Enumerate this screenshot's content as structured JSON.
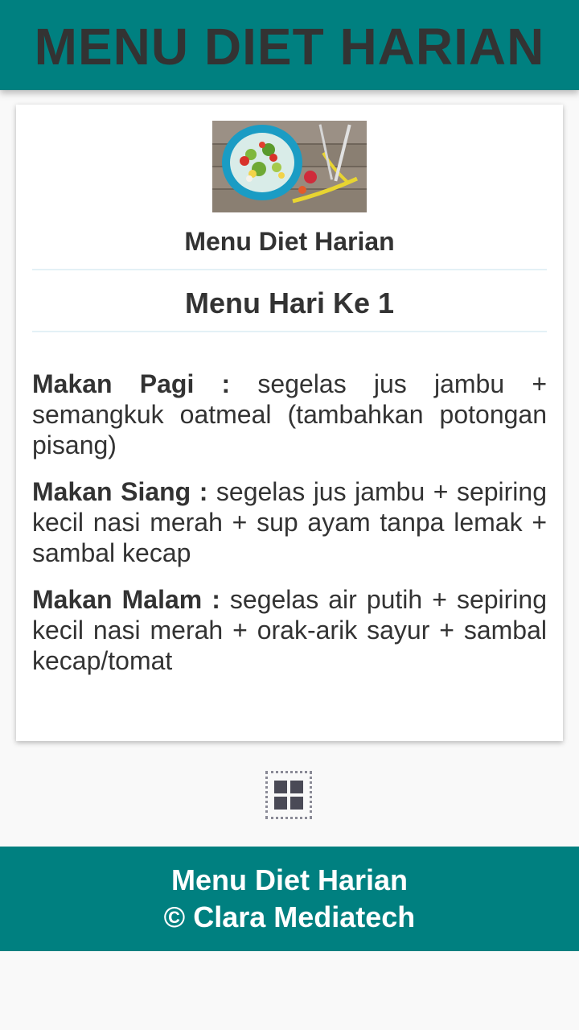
{
  "header": {
    "title": "MENU DIET HARIAN"
  },
  "card": {
    "image_icon": "salad-bowl-icon",
    "title": "Menu Diet Harian",
    "day_title": "Menu Hari Ke 1",
    "meals": [
      {
        "label": "Makan Pagi :",
        "text": " segelas jus jambu + semangkuk oatmeal (tambahkan potongan pisang)"
      },
      {
        "label": "Makan Siang :",
        "text": " segelas jus jambu + sepiring kecil nasi merah + sup ayam tanpa lemak + sambal kecap"
      },
      {
        "label": "Makan Malam :",
        "text": " segelas air putih + sepiring kecil nasi merah + orak-arik sayur + sambal kecap/tomat"
      }
    ]
  },
  "menu_button": {
    "icon": "grid-menu-icon"
  },
  "footer": {
    "line1": "Menu Diet Harian",
    "line2": "© Clara Mediatech"
  },
  "colors": {
    "primary": "#008080",
    "text": "#333333",
    "background": "#f9f9f9"
  }
}
